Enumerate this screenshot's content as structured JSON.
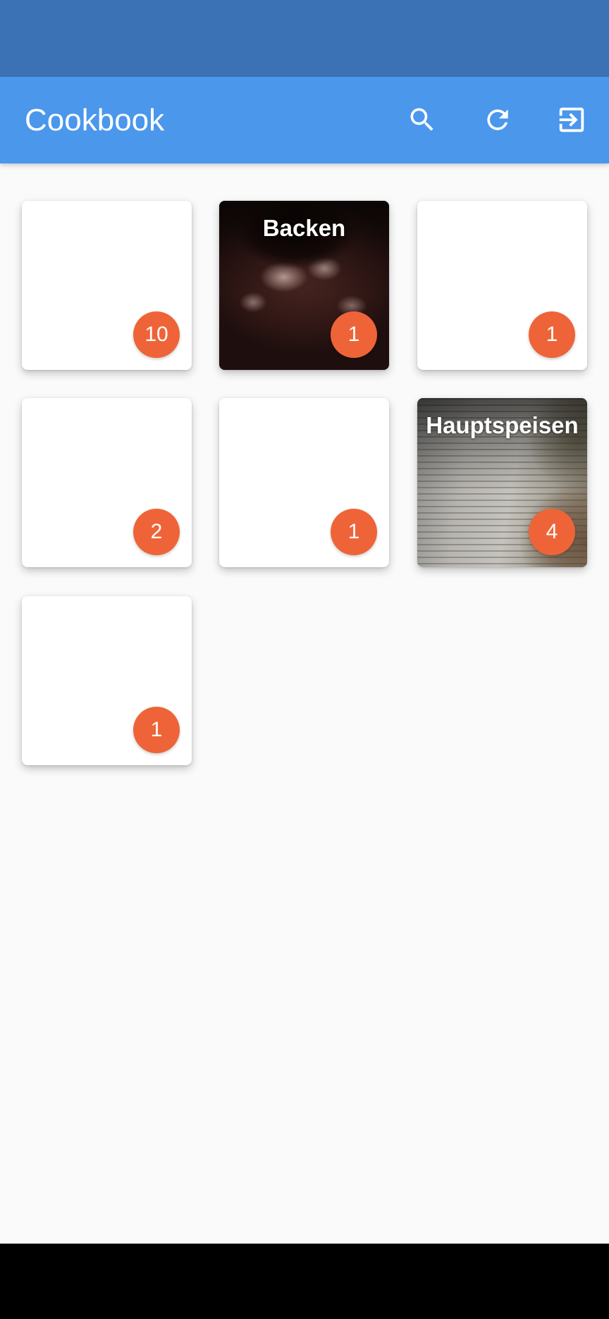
{
  "app_bar": {
    "title": "Cookbook",
    "actions": [
      {
        "icon": "search-icon"
      },
      {
        "icon": "refresh-icon"
      },
      {
        "icon": "logout-icon"
      }
    ]
  },
  "colors": {
    "status_bar": "#3b72b5",
    "app_bar": "#4a97ec",
    "badge": "#ee6438",
    "background": "#fafafa"
  },
  "categories": [
    {
      "title": "",
      "count": "10",
      "has_image": false
    },
    {
      "title": "Backen",
      "count": "1",
      "has_image": true
    },
    {
      "title": "",
      "count": "1",
      "has_image": false
    },
    {
      "title": "",
      "count": "2",
      "has_image": false
    },
    {
      "title": "",
      "count": "1",
      "has_image": false
    },
    {
      "title": "Hauptspeisen",
      "count": "4",
      "has_image": true
    },
    {
      "title": "",
      "count": "1",
      "has_image": false
    }
  ]
}
